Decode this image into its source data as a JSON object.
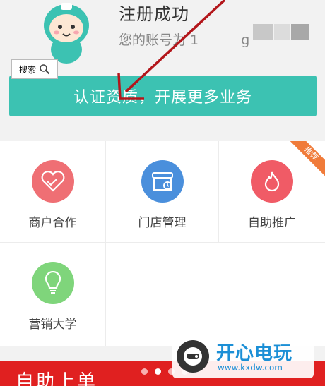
{
  "header": {
    "title": "注册成功",
    "account_prefix": "您的账号为 1",
    "account_masked": "g"
  },
  "search_overlay": {
    "label": "搜索",
    "icon": "search-icon"
  },
  "cta": {
    "label": "认证资质，开展更多业务"
  },
  "grid": {
    "items": [
      {
        "label": "商户合作",
        "icon": "handshake-heart-icon",
        "color": "#ef6f74"
      },
      {
        "label": "门店管理",
        "icon": "store-icon",
        "color": "#4a8fdc"
      },
      {
        "label": "自助推广",
        "icon": "flame-icon",
        "color": "#f05b66",
        "badge": "推荐"
      },
      {
        "label": "营销大学",
        "icon": "lightbulb-icon",
        "color": "#7fd57b"
      }
    ]
  },
  "banner": {
    "text": "自助上单",
    "dots_total": 4,
    "dots_active": 2
  },
  "watermark": {
    "title": "开心电玩",
    "url": "www.kxdw.com"
  },
  "colors": {
    "accent": "#3cc2b2",
    "banner": "#e02020",
    "arrow": "#b3161b"
  }
}
